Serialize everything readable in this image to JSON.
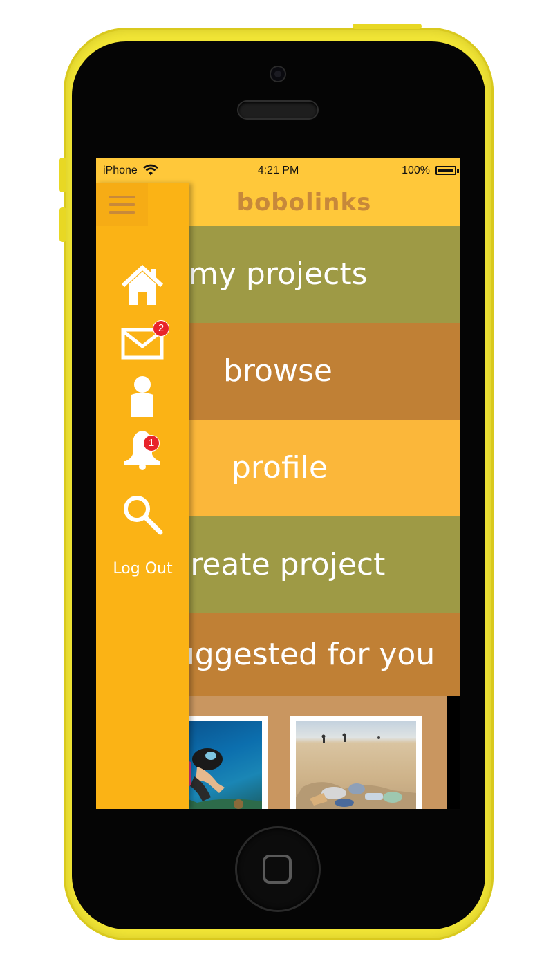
{
  "status_bar": {
    "carrier": "iPhone",
    "time": "4:21 PM",
    "battery": "100%"
  },
  "header": {
    "app_title": "bobolinks"
  },
  "menu": {
    "items": [
      {
        "label": "my projects",
        "color": "#9e9a45"
      },
      {
        "label": "browse",
        "color": "#c08035"
      },
      {
        "label": "profile",
        "color": "#fbb73a"
      },
      {
        "label": "create project",
        "color": "#9e9a45"
      },
      {
        "label": "suggested for you",
        "color": "#c08035"
      }
    ]
  },
  "sidebar": {
    "icons": [
      {
        "name": "home-icon"
      },
      {
        "name": "mail-icon",
        "badge": "2"
      },
      {
        "name": "profile-icon"
      },
      {
        "name": "bell-icon",
        "badge": "1"
      },
      {
        "name": "search-icon"
      }
    ],
    "logout_label": "Log Out",
    "accent": "#fbb315"
  },
  "colors": {
    "header": "#ffc83a",
    "title": "#c7883a",
    "badge": "#e8242b",
    "phone": "#f2e636"
  }
}
